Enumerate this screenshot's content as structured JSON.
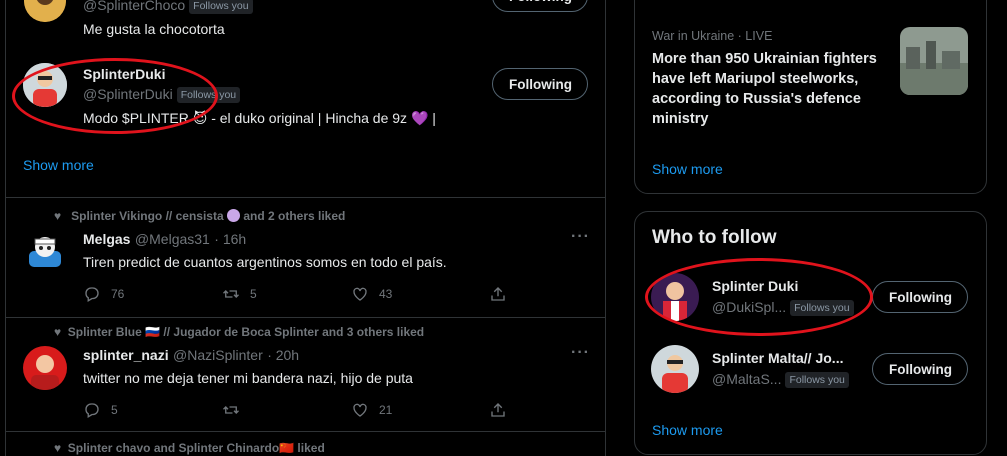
{
  "timeline": {
    "user_top": {
      "handle": "@SplinterChoco",
      "follows_you": "Follows you",
      "bio": "Me gusta la chocotorta"
    },
    "user_duki": {
      "name": "SplinterDuki",
      "handle": "@SplinterDuki",
      "follows_you": "Follows you",
      "bio": "Modo $PLINTER 😈 - el duko original | Hincha de 9z 💜 |",
      "button": "Following"
    },
    "show_more": "Show more",
    "tweets": [
      {
        "social": "Splinter Vikingo // censista",
        "social_suffix": "and 2 others liked",
        "name": "Melgas",
        "handle": "@Melgas31",
        "time": "· 16h",
        "text": "Tiren predict de cuantos argentinos somos en todo el país.",
        "replies": "76",
        "retweets": "5",
        "likes": "43"
      },
      {
        "social": "Splinter Blue 🇷🇺 // Jugador de Boca Splinter and 3 others liked",
        "name": "splinter_nazi",
        "handle": "@NaziSplinter",
        "time": "· 20h",
        "text": "twitter no me deja tener mi bandera nazi, hijo de puta",
        "replies": "5",
        "retweets": "",
        "likes": "21"
      },
      {
        "social": "Splinter chavo and Splinter Chinardo🇨🇳 liked"
      }
    ],
    "top_button": "Following"
  },
  "sidebar": {
    "news": {
      "category": "War in Ukraine · LIVE",
      "headline": "More than 950 Ukrainian fighters have left Mariupol steelworks, according to Russia's defence ministry",
      "show_more": "Show more"
    },
    "who_to_follow": {
      "title": "Who to follow",
      "users": [
        {
          "name": "Splinter Duki",
          "handle": "@DukiSpl...",
          "follows_you": "Follows you",
          "button": "Following"
        },
        {
          "name": "Splinter Malta// Jo...",
          "handle": "@MaltaS...",
          "follows_you": "Follows you",
          "button": "Following"
        }
      ],
      "show_more": "Show more"
    }
  },
  "colors": {
    "accent": "#1d9bf0",
    "annotation": "#e0131c",
    "background": "#000000"
  }
}
